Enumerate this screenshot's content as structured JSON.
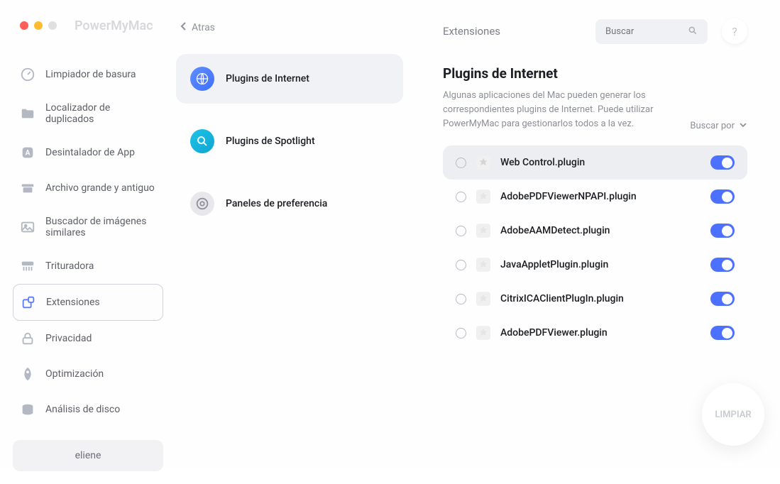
{
  "app": {
    "title": "PowerMyMac"
  },
  "back": {
    "label": "Atras"
  },
  "sidebar": {
    "items": [
      {
        "label": "Limpiador de basura",
        "icon": "speedometer"
      },
      {
        "label": "Localizador de duplicados",
        "icon": "folder"
      },
      {
        "label": "Desintalador de App",
        "icon": "app"
      },
      {
        "label": "Archivo grande y antiguo",
        "icon": "archive"
      },
      {
        "label": "Buscador de imágenes similares",
        "icon": "image"
      },
      {
        "label": "Trituradora",
        "icon": "shredder"
      },
      {
        "label": "Extensiones",
        "icon": "extensions"
      },
      {
        "label": "Privacidad",
        "icon": "lock"
      },
      {
        "label": "Optimización",
        "icon": "rocket"
      },
      {
        "label": "Análisis de disco",
        "icon": "disk"
      }
    ],
    "user": "eliene"
  },
  "categories": [
    {
      "label": "Plugins de Internet"
    },
    {
      "label": "Plugins de Spotlight"
    },
    {
      "label": "Paneles de preferencia"
    }
  ],
  "main": {
    "section": "Extensiones",
    "search_placeholder": "Buscar",
    "headline": "Plugins de Internet",
    "description": "Algunas aplicaciones del Mac pueden generar los correspondientes plugins de Internet. Puede utilizar PowerMyMac para gestionarlos todos a la vez.",
    "sort_label": "Buscar por",
    "plugins": [
      {
        "name": "Web Control.plugin"
      },
      {
        "name": "AdobePDFViewerNPAPI.plugin"
      },
      {
        "name": "AdobeAAMDetect.plugin"
      },
      {
        "name": "JavaAppletPlugin.plugin"
      },
      {
        "name": "CitrixICAClientPlugIn.plugin"
      },
      {
        "name": "AdobePDFViewer.plugin"
      }
    ],
    "clean_label": "LIMPIAR"
  }
}
